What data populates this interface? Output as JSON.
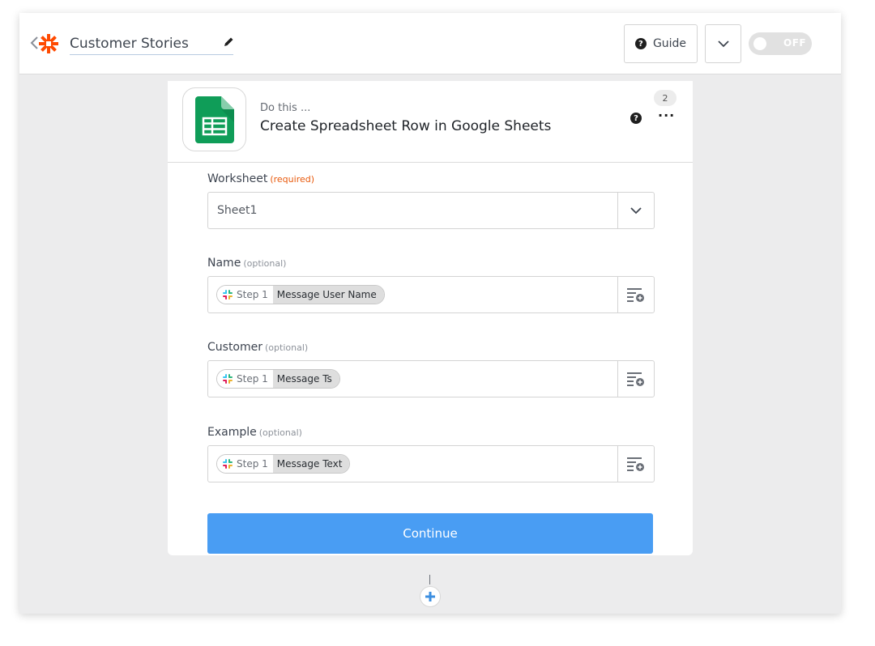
{
  "header": {
    "zap_title": "Customer Stories",
    "guide_label": "Guide",
    "toggle_label": "OFF"
  },
  "step": {
    "prefix": "Do this ...",
    "title": "Create Spreadsheet Row in Google Sheets",
    "number": "2",
    "app_icon": "google-sheets-icon"
  },
  "fields": {
    "worksheet": {
      "label": "Worksheet",
      "qualifier": "(required)",
      "value": "Sheet1"
    },
    "name": {
      "label": "Name",
      "qualifier": "(optional)",
      "pill_step": "Step 1",
      "pill_field": "Message User Name"
    },
    "customer": {
      "label": "Customer",
      "qualifier": "(optional)",
      "pill_step": "Step 1",
      "pill_field": "Message Ts"
    },
    "example": {
      "label": "Example",
      "qualifier": "(optional)",
      "pill_step": "Step 1",
      "pill_field": "Message Text"
    }
  },
  "continue_label": "Continue",
  "colors": {
    "brand_orange": "#ff4a00",
    "primary_blue": "#499df3",
    "required_orange": "#e8590c",
    "sheets_green": "#0f9d58"
  }
}
